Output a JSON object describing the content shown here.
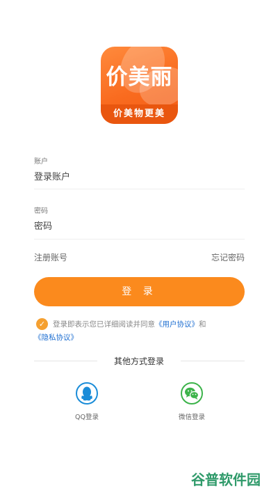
{
  "logo": {
    "brand_text": "价美丽",
    "slogan": "价美物更美"
  },
  "account": {
    "label": "账户",
    "placeholder": "登录账户"
  },
  "password": {
    "label": "密码",
    "placeholder": "密码"
  },
  "links": {
    "register": "注册账号",
    "forgot": "忘记密码"
  },
  "login_button": "登 录",
  "agreement": {
    "prefix": "登录即表示您已详细阅读并同意",
    "user_protocol": "《用户协议》",
    "and": "和",
    "privacy_protocol": "《隐私协议》"
  },
  "other_login": {
    "title": "其他方式登录",
    "qq_label": "QQ登录",
    "wechat_label": "微信登录"
  },
  "watermark": "谷普软件园",
  "colors": {
    "accent": "#fb8a1d",
    "link": "#1f6fd1",
    "qq": "#1a8cd8",
    "wechat": "#3cb34a"
  }
}
